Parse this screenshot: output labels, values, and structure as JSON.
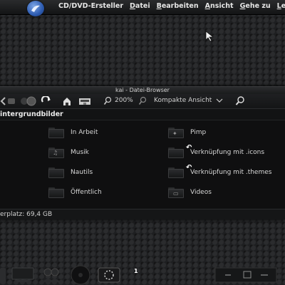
{
  "top_panel": {
    "app_name": "CD/DVD-Ersteller",
    "menus": [
      {
        "label": "Datei",
        "underline": "D",
        "rest": "atei"
      },
      {
        "label": "Bearbeiten",
        "underline": "B",
        "rest": "earbeiten"
      },
      {
        "label": "Ansicht",
        "underline": "A",
        "rest": "nsicht"
      },
      {
        "label": "Gehe zu",
        "underline": "G",
        "rest": "ehe zu"
      },
      {
        "label": "Le",
        "underline": "L",
        "rest": "e"
      }
    ]
  },
  "window": {
    "title": "kai - Datei-Browser",
    "toolbar": {
      "zoom_level": "200%",
      "view_mode": "Kompakte Ansicht"
    },
    "path": "intergrundbilder",
    "items": [
      {
        "name": "In Arbeit",
        "icon": "folder-icon",
        "link": false
      },
      {
        "name": "Pimp",
        "icon": "folder-icon",
        "link": false
      },
      {
        "name": "Musik",
        "icon": "music-folder-icon",
        "link": false
      },
      {
        "name": "Verknüpfung mit .icons",
        "icon": "folder-icon",
        "link": true
      },
      {
        "name": "Nautils",
        "icon": "folder-icon",
        "link": false
      },
      {
        "name": "Verknüpfung mit .themes",
        "icon": "folder-icon",
        "link": true
      },
      {
        "name": "Öffentlich",
        "icon": "folder-icon",
        "link": false
      },
      {
        "name": "Videos",
        "icon": "video-folder-icon",
        "link": false
      }
    ],
    "status": "erplatz: 69,4 GB"
  },
  "dock": {
    "page_number": "1"
  }
}
